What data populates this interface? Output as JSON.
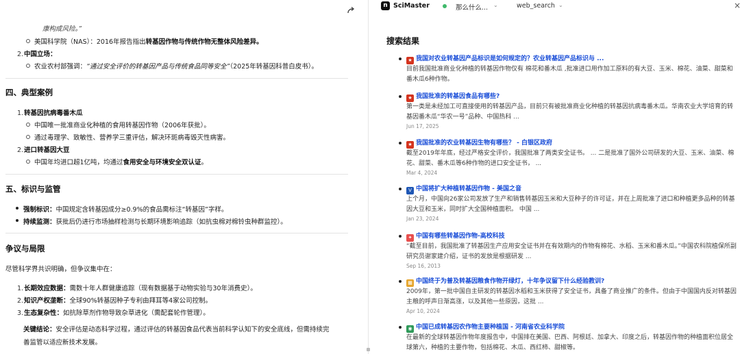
{
  "left": {
    "share_icon": "share-icon",
    "cont_line": "康构成风险。”",
    "nas_label": "美国科学院（NAS）：",
    "nas_text": "2016年报告指出",
    "nas_bold": "转基因作物与传统作物无整体风险差异。",
    "china_num": "2.",
    "china_label": "中国立场：",
    "moa_label": "农业农村部强调：",
    "moa_quote": "“通过安全评价的转基因产品与传统食品同等安全”",
    "moa_src": "（2025年转基因科普白皮书）。",
    "sec4": "四、典型案例",
    "case1_num": "1.",
    "case1_title": "转基因抗病毒番木瓜",
    "case1_b1": "中国唯一批准商业化种植的食用转基因作物（2006年获批）。",
    "case1_b2": "通过毒理学、致敏性、营养学三重评估，解决环斑病毒毁灭性病害。",
    "case2_num": "2.",
    "case2_title": "进口转基因大豆",
    "case2_b1_pre": "中国年均进口超1亿吨，均通过",
    "case2_b1_bold": "食用安全与环境安全双认证",
    "case2_b1_post": "。",
    "sec5": "五、标识与监管",
    "label_title": "强制标识：",
    "label_text": "中国规定含转基因成分≥0.9%的食品需标注“转基因”字样。",
    "monitor_title": "持续监测：",
    "monitor_text": "获批后仍进行市场抽样检测与长期环境影响追踪（如抗虫棉对棉铃虫种群监控）。",
    "sec6": "争议与局限",
    "intro": "尽管科学界共识明确，但争议集中在：",
    "d1_num": "1.",
    "d1_title": "长期效应数据：",
    "d1_text": "需数十年人群健康追踪（现有数据基于动物实验与30年消费史）。",
    "d2_num": "2.",
    "d2_title": "知识产权垄断：",
    "d2_text": "全球90%转基因种子专利由拜耳等4家公司控制。",
    "d3_num": "3.",
    "d3_title": "生态复杂性：",
    "d3_text": "如抗除草剂作物导致杂草进化（需配套轮作管理）。",
    "conc_title": "关键结论：",
    "conc_text": "安全评估是动态科学过程，通过评估的转基因食品代表当前科学认知下的安全底线，但需持续完善监管以适应新技术发展。"
  },
  "right": {
    "logo_icon": "scimaster-logo-icon",
    "app_name": "SciMaster",
    "query1": "那么什么...",
    "query2": "web_search",
    "chevron": "⌄",
    "close": "×",
    "results_title": "搜索结果",
    "results": [
      {
        "icon": "gov-emblem-icon",
        "color": "#d4341f",
        "title": "我国对农业转基因产品标识是如何规定的？农业转基因产品标识与 ...",
        "snippet": "目前我国批准商业化种植的转基因作物仅有 棉花和番木瓜 ,批准进口用作加工原料的有大豆、玉米、棉花、油菜、甜菜和番木瓜6种作物。",
        "date": ""
      },
      {
        "icon": "gov-emblem-icon",
        "color": "#d4341f",
        "title": "我国批准的转基因食品有哪些?",
        "snippet": "第一类是未经加工可直接使用的转基因产品，目前只有被批准商业化种植的转基因抗病毒番木瓜。华南农业大学培育的转基因番木瓜“华农一号”品种、中国热科 ...",
        "date": "Jun 17, 2025"
      },
      {
        "icon": "gov-emblem-icon",
        "color": "#d4341f",
        "title": "我国批准的农业转基因生物有哪些？ - 白银区政府",
        "snippet": "截至2019年年底，经过严格安全评价，我国批准了两类安全证书。 ... 二是批准了国外公司研发的大豆、玉米、油菜、棉花、甜菜、番木瓜等6种作物的进口安全证书， ...",
        "date": "Mar 4, 2024"
      },
      {
        "icon": "voa-icon",
        "color": "#1f57b5",
        "title": "中国将扩大种植转基因作物 - 美国之音",
        "snippet": "上个月，中国向26家公司发放了生产和销售转基因玉米和大豆种子的许可证，并在上周批准了进口和种植更多品种的转基因大豆和玉米，同时扩大全国种植面积。 中国 ...",
        "date": "Jan 23, 2024"
      },
      {
        "icon": "kepu-icon",
        "color": "#e8504f",
        "title": "中国有哪些转基因作物-高校科技",
        "snippet": "“截至目前，我国批准了转基因生产应用安全证书并在有效期内的作物有棉花、水稻、玉米和番木瓜。”中国农科院植保所副研究员谢家建介绍，证书的发放是根据研发 ...",
        "date": "Sep 16, 2013"
      },
      {
        "icon": "grid-icon",
        "color": "#e6a52c",
        "title": "中国终于为普及转基因粮食作物开绿灯，十年争议留下什么经验教训?",
        "snippet": "2009年，第一批中国自主研发的转基因水稻和玉米获得了安全证书，具备了商业推广的条件。但由于中国国内反对转基因主粮的呼声日渐高涨，以及其他一些原因，这批 ...",
        "date": "Apr 10, 2024"
      },
      {
        "icon": "globe-icon",
        "color": "#2f9a5a",
        "title": "中国已成转基因农作物主要种植国 - 河南省农业科学院",
        "snippet": "在最新的全球转基因作物年度报告中，中国排在美国、巴西、阿根廷、加拿大、印度之后，转基因作物的种植面积位居全球第六，种植的主要作物，包括棉花、木瓜、西红柿、甜椒等。",
        "date": ""
      }
    ]
  }
}
